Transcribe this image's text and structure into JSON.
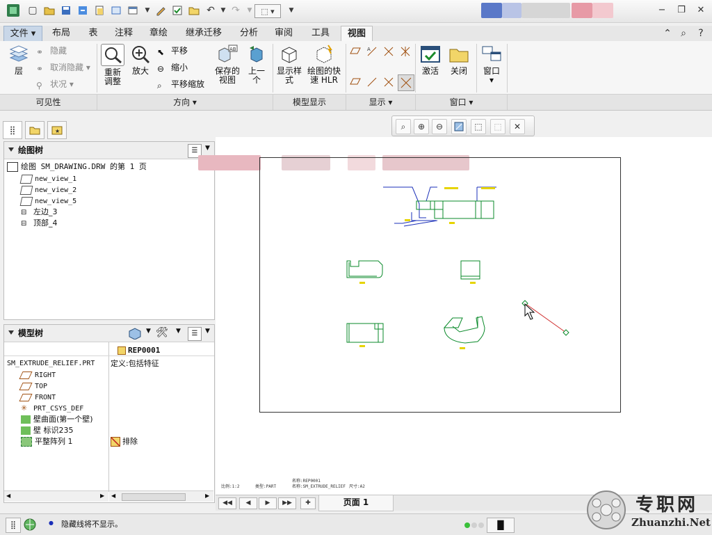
{
  "quick_access": {
    "icons": [
      "new-icon",
      "open-icon",
      "save-icon",
      "regen-icon",
      "clipboard-icon",
      "switch-icon",
      "window-icon",
      "edit-icon",
      "check-icon",
      "folder-icon",
      "undo-icon",
      "redo-icon",
      "select-box-icon",
      "overflow-icon"
    ]
  },
  "ribbon_tabs": {
    "file": "文件",
    "tabs": [
      "布局",
      "表",
      "注释",
      "章绘",
      "继承迁移",
      "分析",
      "审阅",
      "工具",
      "视图"
    ],
    "active": "视图"
  },
  "ribbon": {
    "visibility": {
      "layer": "层",
      "hide": "隐藏",
      "unhide": "取消隐藏",
      "status": "状况",
      "group": "可见性"
    },
    "orientation": {
      "refit": "重新\n调整",
      "zoom_in": "放大",
      "pan": "平移",
      "zoom_out": "缩小",
      "pan_zoom": "平移缩放",
      "saved_views": "保存的\n视图",
      "previous": "上一\n个",
      "group": "方向"
    },
    "model_display": {
      "display_style": "显示样\n式",
      "fast_hlr": "绘图的快\n速 HLR",
      "group": "模型显示"
    },
    "show": {
      "group": "显示"
    },
    "window": {
      "activate": "激活",
      "close": "关闭",
      "window": "窗口",
      "group": "窗口"
    }
  },
  "drawing_tree": {
    "title": "绘图树",
    "root": "绘图 SM_DRAWING.DRW 的第 1 页",
    "items": [
      "new_view_1",
      "new_view_2",
      "new_view_5",
      "左边_3",
      "顶部_4"
    ]
  },
  "model_tree": {
    "title": "模型树",
    "column": "REP0001",
    "part": "SM_EXTRUDE_RELIEF.PRT",
    "part_value": "定义:包括特征",
    "items": [
      "RIGHT",
      "TOP",
      "FRONT",
      "PRT_CSYS_DEF",
      "壁曲面(第一个壁)",
      "壁 标识235",
      "平整阵列 1"
    ],
    "exclude_label": "排除"
  },
  "canvas": {
    "footer_scale": "比例:1:2",
    "footer_type": "类型:PART",
    "footer_rep_top": "名称:REP0001",
    "footer_name": "名称:SM_EXTRUDE_RELIEF",
    "footer_size": "尺寸:A2"
  },
  "page_nav": {
    "page_label": "页面 1"
  },
  "status": {
    "message": "隐藏线将不显示。"
  },
  "watermark": {
    "text": "专职网",
    "url": "Zhuanzhi.Net"
  },
  "colors": {
    "ribbon_tab_file": "#c9d7e8",
    "geometry_green": "#0a8a2a",
    "geometry_blue": "#1a2fb8",
    "dimension_yellow": "#e6d400",
    "sketch_red": "#d03030"
  }
}
